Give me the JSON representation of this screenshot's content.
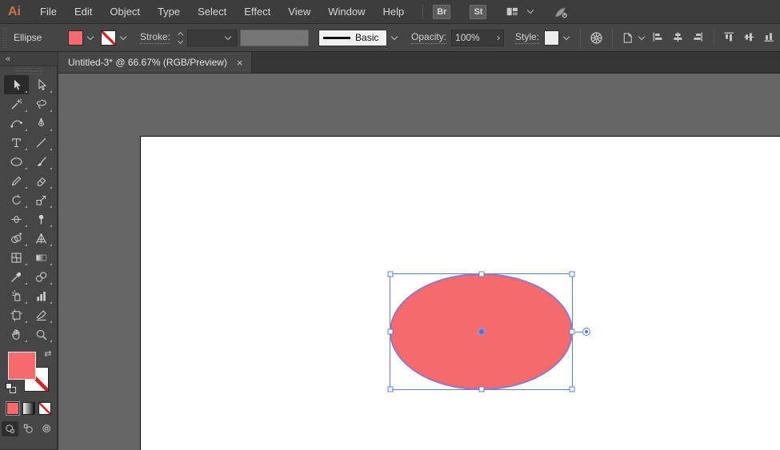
{
  "app": {
    "logo_text": "Ai"
  },
  "menubar": {
    "items": [
      "File",
      "Edit",
      "Object",
      "Type",
      "Select",
      "Effect",
      "View",
      "Window",
      "Help"
    ],
    "bridge_button": "Br",
    "stock_button": "St",
    "workspace_icon": "workspace-switcher-icon",
    "gpu_icon": "gpu-performance-icon"
  },
  "control_bar": {
    "context_label": "Ellipse",
    "fill_color": "#F56A6A",
    "stroke_color": "none",
    "stroke_label": "Stroke:",
    "stroke_weight_value": "",
    "brush_name": "Basic",
    "opacity_label": "Opacity:",
    "opacity_value": "100%",
    "style_label": "Style:",
    "icons": [
      "recolor-artwork-icon",
      "align-to-icon"
    ],
    "align_buttons": [
      "align-left",
      "align-h-center",
      "align-right",
      "align-top",
      "align-v-middle",
      "align-bottom"
    ]
  },
  "tab_bar": {
    "active_tab": {
      "title": "Untitled-3* @ 66.67% (RGB/Preview)",
      "close_glyph": "×"
    }
  },
  "toolbar": {
    "collapse_glyph": "«",
    "active_tool": "selection",
    "tools": [
      {
        "id": "selection",
        "active": true
      },
      {
        "id": "direct-selection"
      },
      {
        "id": "magic-wand"
      },
      {
        "id": "lasso"
      },
      {
        "id": "curvature"
      },
      {
        "id": "pen"
      },
      {
        "id": "type"
      },
      {
        "id": "line-segment"
      },
      {
        "id": "ellipse"
      },
      {
        "id": "paintbrush"
      },
      {
        "id": "shaper"
      },
      {
        "id": "eraser"
      },
      {
        "id": "rotate"
      },
      {
        "id": "scale"
      },
      {
        "id": "width"
      },
      {
        "id": "puppet-warp"
      },
      {
        "id": "shape-builder"
      },
      {
        "id": "perspective-grid"
      },
      {
        "id": "mesh"
      },
      {
        "id": "gradient"
      },
      {
        "id": "eyedropper"
      },
      {
        "id": "blend"
      },
      {
        "id": "symbol-sprayer"
      },
      {
        "id": "column-graph"
      },
      {
        "id": "artboard"
      },
      {
        "id": "slice"
      },
      {
        "id": "hand"
      },
      {
        "id": "zoom"
      }
    ],
    "swap_glyph": "⇄",
    "swatch_buttons": [
      "color",
      "gradient",
      "none"
    ],
    "draw_modes": [
      "draw-normal",
      "draw-behind",
      "draw-inside"
    ],
    "active_draw_mode": "draw-normal"
  },
  "canvas": {
    "selection": {
      "shape": "ellipse",
      "fill_color": "#F56A6A",
      "selection_color": "#5580E0"
    }
  },
  "colors": {
    "ui_dark": "#3D3D3D",
    "ui_mid": "#454545",
    "canvas_bg": "#666666",
    "artboard": "#FFFFFF",
    "accent_fill": "#F56A6A",
    "selection_blue": "#5580E0",
    "none_slash_red": "#D92121",
    "logo_orange": "#C9763F"
  }
}
